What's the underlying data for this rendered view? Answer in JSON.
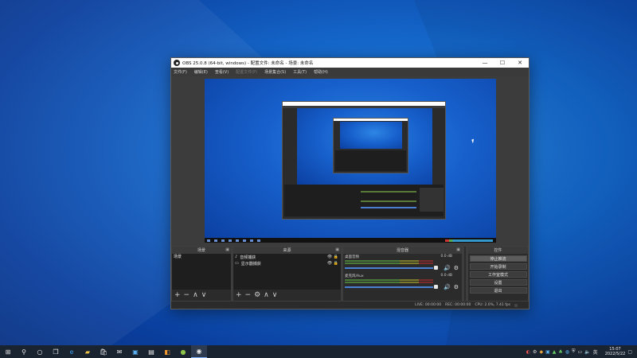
{
  "window": {
    "title": "OBS 25.0.8 (64-bit, windows) - 配置文件: 未命名 - 场景: 未命名",
    "controls": [
      "—",
      "☐",
      "✕"
    ]
  },
  "menu": [
    {
      "label": "文件(F)",
      "enabled": true
    },
    {
      "label": "编辑(E)",
      "enabled": true
    },
    {
      "label": "查看(V)",
      "enabled": true
    },
    {
      "label": "配置文件(P)",
      "enabled": false
    },
    {
      "label": "场景集合(S)",
      "enabled": true
    },
    {
      "label": "工具(T)",
      "enabled": true
    },
    {
      "label": "帮助(H)",
      "enabled": true
    }
  ],
  "docks": {
    "scenes": {
      "title": "场景",
      "items": [
        "场景"
      ]
    },
    "sources": {
      "title": "来源",
      "items": [
        {
          "label": "音频捕获",
          "icon": "speaker-icon"
        },
        {
          "label": "显示器捕获",
          "icon": "monitor-icon"
        }
      ]
    },
    "mixer": {
      "title": "混音器",
      "channels": [
        {
          "name": "桌面音频",
          "db": "0.0 dB"
        },
        {
          "name": "麦克风/Aux",
          "db": "0.0 dB"
        }
      ]
    },
    "transitions": {
      "title": ""
    },
    "controls": {
      "title": "控件",
      "buttons": [
        {
          "label": "停止推流",
          "active": true
        },
        {
          "label": "开始录制",
          "active": false
        },
        {
          "label": "工作室模式",
          "active": false
        },
        {
          "label": "设置",
          "active": false
        },
        {
          "label": "退出",
          "active": false
        }
      ]
    }
  },
  "footer_icons": {
    "scenes": [
      "+",
      "−",
      "∧",
      "∨"
    ],
    "sources": [
      "+",
      "−",
      "⚙",
      "∧",
      "∨"
    ]
  },
  "status": {
    "live_label": "LIVE:",
    "live_time": "00:00:00",
    "rec_label": "REC:",
    "rec_time": "00:00:00",
    "cpu": "CPU: 2.0%, 7.41 fps"
  },
  "taskbar": {
    "clock_time": "15:07",
    "clock_date": "2022/5/22"
  },
  "colors": {
    "accent": "#4a7fd4",
    "dock_bg": "#2b2b2b",
    "desktop": "#1466c9"
  }
}
